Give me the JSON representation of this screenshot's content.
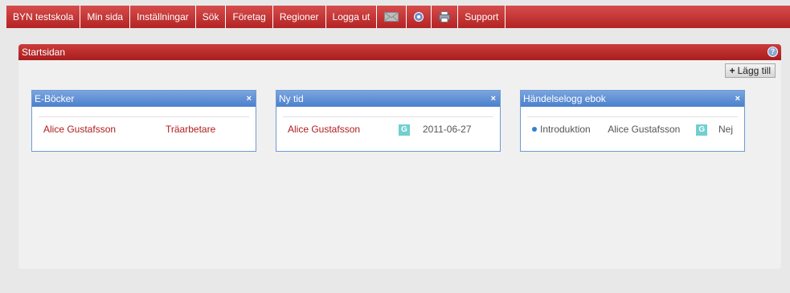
{
  "nav": {
    "items": [
      {
        "label": "BYN testskola"
      },
      {
        "label": "Min sida"
      },
      {
        "label": "Inställningar"
      },
      {
        "label": "Sök"
      },
      {
        "label": "Företag"
      },
      {
        "label": "Regioner"
      },
      {
        "label": "Logga ut"
      }
    ],
    "support_label": "Support"
  },
  "panel": {
    "title": "Startsidan",
    "help_icon": "?",
    "add_label": "Lägg till"
  },
  "widgets": {
    "ebooks": {
      "title": "E-Böcker",
      "close": "×",
      "row": {
        "name": "Alice Gustafsson",
        "profession": "Träarbetare"
      }
    },
    "newtime": {
      "title": "Ny tid",
      "close": "×",
      "row": {
        "name": "Alice Gustafsson",
        "badge": "G",
        "date": "2011-06-27"
      }
    },
    "eventlog": {
      "title": "Händelselogg ebok",
      "close": "×",
      "row": {
        "event": "Introduktion",
        "name": "Alice Gustafsson",
        "badge": "G",
        "value": "Nej"
      }
    }
  },
  "colors": {
    "nav_red": "#c43030",
    "widget_blue": "#5b8fd6",
    "link_red": "#b01c1c",
    "badge_teal": "#6fd0cf"
  }
}
